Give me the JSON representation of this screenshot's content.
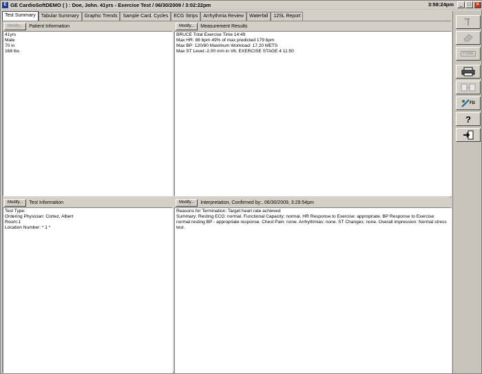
{
  "window": {
    "title": "GE CardioSoftDEMO ( ) : Doe, John. 41yrs  -  Exercise Test / 06/30/2009 / 3:02:22pm",
    "clock": "3:58:24pm",
    "app_icon_text": "E"
  },
  "tabs": [
    {
      "label": "Test Summary",
      "active": true
    },
    {
      "label": "Tabular Summary",
      "active": false
    },
    {
      "label": "Graphic Trends",
      "active": false
    },
    {
      "label": "Sample Card. Cycles",
      "active": false
    },
    {
      "label": "ECG Strips",
      "active": false
    },
    {
      "label": "Arrhythmia Review",
      "active": false
    },
    {
      "label": "Waterfall",
      "active": false
    },
    {
      "label": "12SL Report",
      "active": false
    }
  ],
  "panels": {
    "patient": {
      "modify_label": "Modify...",
      "title": "Patient Information",
      "lines": [
        "41yrs",
        "Male",
        "70 in",
        "168 lbs"
      ]
    },
    "measurement": {
      "modify_label": "Modify...",
      "title": "Measurement Results",
      "lines": [
        "BRUCE    Total Exercise Time 14:49",
        "Max HR: 88 bpm   49% of max predicted 179 bpm",
        "Max BP: 120/80   Maximum Workload: 17.20 METS",
        "Max ST Level:-2.00 mm in V6; EXERCISE STAGE 4 11:50"
      ]
    },
    "testinfo": {
      "modify_label": "Modify...",
      "title": "Test Information",
      "lines": [
        "Test Type:",
        "Ordering Physician: Cortez, Albert",
        "Room:1",
        "Location Number: * 1 *"
      ]
    },
    "interpretation": {
      "modify_label": "Modify...",
      "title": "Interpretation,   Confirmed by:, 06/30/2009, 3:29:54pm",
      "lines": [
        "Reasons for Termination: Target heart rate achieved",
        "Summary: Resting ECG: normal.  Functional Capacity: normal.  HR Response to Exercise: appropriate.  BP Response to Exercise: normal resting BP - appropriate response.  Chest Pain: none.  Arrhythmias: none.  ST Changes: none.  Overall impression: Normal stress test."
      ]
    }
  },
  "toolbar": {
    "buttons": [
      {
        "name": "new-test-icon",
        "enabled": false
      },
      {
        "name": "eraser-icon",
        "enabled": false
      },
      {
        "name": "fuse-icon",
        "label": "FUSE",
        "enabled": false
      },
      {
        "name": "printer-icon",
        "enabled": true
      },
      {
        "name": "compare-icon",
        "enabled": false
      },
      {
        "name": "full-disclosure-icon",
        "label": "FD",
        "enabled": true
      },
      {
        "name": "help-icon",
        "label": "?",
        "enabled": true
      },
      {
        "name": "exit-icon",
        "enabled": true
      }
    ]
  }
}
